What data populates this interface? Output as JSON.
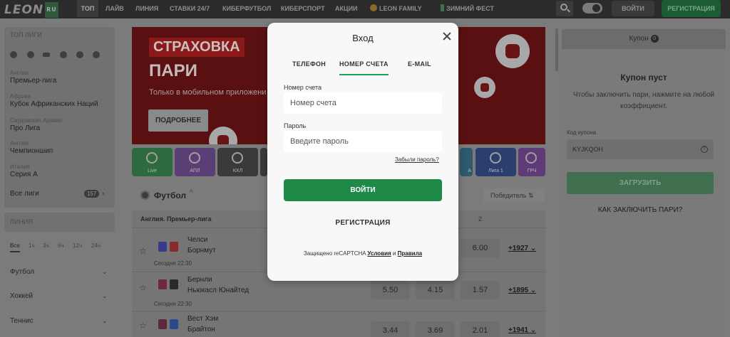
{
  "header": {
    "logo": "LEON",
    "logo_badge": "RU",
    "nav": [
      "ТОП",
      "ЛАЙВ",
      "ЛИНИЯ",
      "СТАВКИ 24/7",
      "КИБЕРФУТБОЛ",
      "КИБЕРСПОРТ",
      "АКЦИИ",
      "LEON FAMILY",
      "ЗИМНИЙ ФЕСТ"
    ],
    "login": "ВОЙТИ",
    "register": "РЕГИСТРАЦИЯ"
  },
  "sidebar": {
    "top_title": "ТОП ЛИГИ",
    "leagues": [
      {
        "country": "Англия",
        "name": "Премьер-лига"
      },
      {
        "country": "Африка",
        "name": "Кубок Африканских Наций"
      },
      {
        "country": "Саудовская Аравия",
        "name": "Про Лига"
      },
      {
        "country": "Англия",
        "name": "Чемпионшип"
      },
      {
        "country": "Италия",
        "name": "Серия А"
      }
    ],
    "all_leagues": "Все лиги",
    "all_leagues_count": "157",
    "line_title": "ЛИНИЯ",
    "filters": [
      "Все",
      "1ч",
      "3ч",
      "6ч",
      "12ч",
      "24ч"
    ],
    "sports": [
      "Футбол",
      "Хоккей",
      "Теннис"
    ]
  },
  "banner": {
    "label": "СТРАХОВКА",
    "big": "ПАРИ",
    "sub": "Только в мобильном приложени",
    "button": "ПОДРОБНЕЕ"
  },
  "tiles": [
    "Live",
    "АПЛ",
    "КХЛ",
    "",
    "",
    "",
    "",
    "А",
    "Лига 1",
    "ГРЧ"
  ],
  "section": {
    "title": "Футбол",
    "sort": "Победитель",
    "league": "Англия. Премьер-лига",
    "col2": "2"
  },
  "matches": [
    {
      "home": "Челси",
      "away": "Борнмут",
      "date": "Сегодня",
      "time": "22:30",
      "odds": [
        "",
        "",
        "6.00"
      ],
      "more": "+1927"
    },
    {
      "home": "Бернли",
      "away": "Ньюкасл Юнайтед",
      "date": "Сегодня",
      "time": "22:30",
      "odds": [
        "5.50",
        "4.15",
        "1.57"
      ],
      "more": "+1895"
    },
    {
      "home": "Вест Хэм",
      "away": "Брайтон",
      "date": "",
      "time": "",
      "odds": [
        "3.44",
        "3.69",
        "2.01"
      ],
      "more": "+1941"
    }
  ],
  "coupon": {
    "tab": "Купон",
    "count": "0",
    "empty": "Купон пуст",
    "desc": "Чтобы заключить пари, нажмите на любой коэффициент.",
    "code_label": "Код купона",
    "code_value": "KYJKQOH",
    "load": "ЗАГРУЗИТЬ",
    "how": "КАК ЗАКЛЮЧИТЬ ПАРИ?"
  },
  "modal": {
    "title": "Вход",
    "tabs": [
      "ТЕЛЕФОН",
      "НОМЕР СЧЕТА",
      "E-MAIL"
    ],
    "account_label": "Номер счета",
    "account_placeholder": "Номер счета",
    "password_label": "Пароль",
    "password_placeholder": "Введите пароль",
    "forgot": "Забыли пароль?",
    "submit": "ВОЙТИ",
    "register": "РЕГИСТРАЦИЯ",
    "captcha_text": "Защищено reCAPTCHA",
    "captcha_terms": "Условия",
    "captcha_and": "и",
    "captcha_rules": "Правила"
  }
}
